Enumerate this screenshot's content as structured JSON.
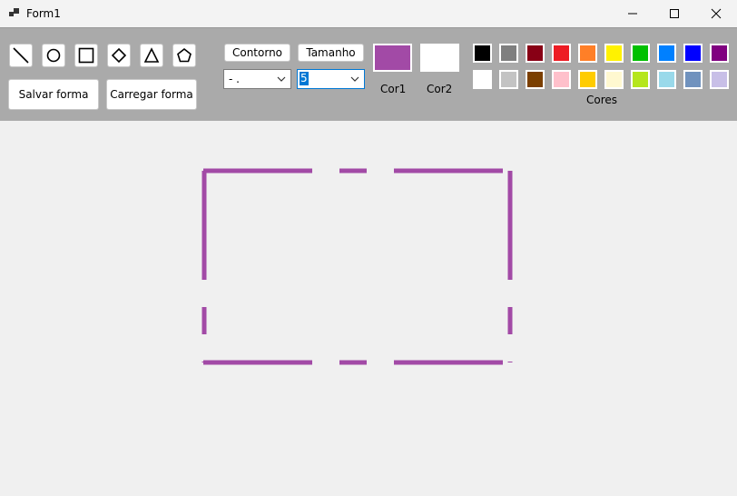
{
  "window": {
    "title": "Form1"
  },
  "shapes": [
    "line",
    "circle",
    "square",
    "diamond",
    "triangle",
    "pentagon"
  ],
  "actions": {
    "save": "Salvar forma",
    "load": "Carregar forma"
  },
  "outline": {
    "button": "Contorno",
    "value": "- ."
  },
  "size": {
    "button": "Tamanho",
    "value": "5"
  },
  "colors": {
    "cor1_label": "Cor1",
    "cor2_label": "Cor2",
    "cor1": "#a24aa6",
    "cor2": "#ffffff",
    "palette_label": "Cores",
    "row1": [
      "#000000",
      "#7f7f7f",
      "#880015",
      "#ed1c24",
      "#ff7f27",
      "#fff200",
      "#00c000",
      "#0080ff",
      "#0000ff",
      "#800080"
    ],
    "row2": [
      "#ffffff",
      "#c3c3c3",
      "#7b3f00",
      "#ffc0cb",
      "#ffcc00",
      "#fff8d0",
      "#b5e61d",
      "#99d9ea",
      "#7092be",
      "#c8bfe7"
    ]
  },
  "drawing": {
    "shape": "rectangle",
    "stroke": "#a24aa6",
    "dash": "dash-dot"
  }
}
